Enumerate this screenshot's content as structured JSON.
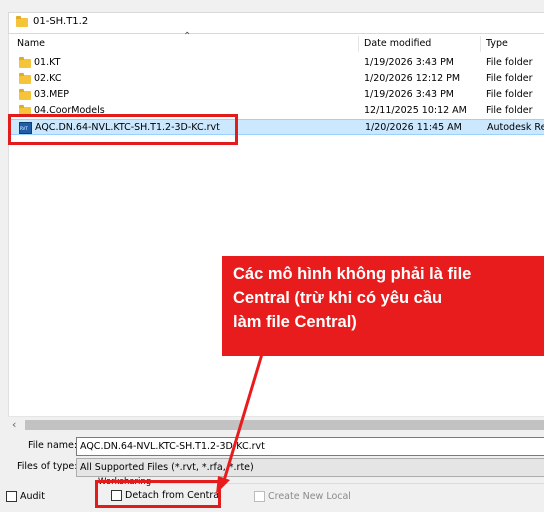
{
  "path_bar": {
    "folder": "01-SH.T1.2"
  },
  "columns": {
    "name": "Name",
    "date": "Date modified",
    "type": "Type"
  },
  "files": [
    {
      "name": "01.KT",
      "date": "1/19/2026 3:43 PM",
      "type": "File folder",
      "icon": "folder-icon"
    },
    {
      "name": "02.KC",
      "date": "1/20/2026 12:12 PM",
      "type": "File folder",
      "icon": "folder-icon"
    },
    {
      "name": "03.MEP",
      "date": "1/19/2026 3:43 PM",
      "type": "File folder",
      "icon": "folder-icon"
    },
    {
      "name": "04.CoorModels",
      "date": "12/11/2025 10:12 AM",
      "type": "File folder",
      "icon": "folder-icon"
    },
    {
      "name": "AQC.DN.64-NVL.KTC-SH.T1.2-3D-KC.rvt",
      "date": "1/20/2026 11:45 AM",
      "type": "Autodesk Rev",
      "icon": "revit-file-icon",
      "selected": true
    }
  ],
  "file_name": {
    "label": "File name:",
    "value": "AQC.DN.64-NVL.KTC-SH.T1.2-3D-KC.rvt"
  },
  "file_type": {
    "label": "Files of type:",
    "value": "All Supported Files (*.rvt, *.rfa, *.rte)"
  },
  "options": {
    "audit": "Audit",
    "worksharing": "Worksharing",
    "detach": "Detach from Central",
    "create_new_local": "Create New Local"
  },
  "callout": {
    "line1": "Các mô hình không phải là file",
    "line2": "Central (trừ khi có yêu cầu",
    "line3": "làm file Central)"
  },
  "colors": {
    "annotation_red": "#e21b1b",
    "selection": "#cce8ff",
    "folder": "#f5c43b"
  }
}
